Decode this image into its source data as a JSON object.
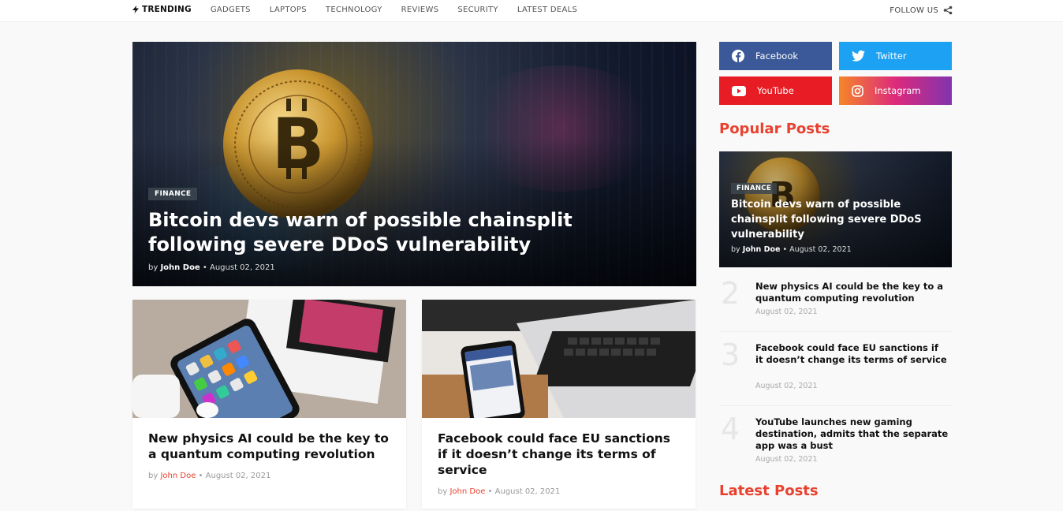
{
  "nav": {
    "trending": "TRENDING",
    "items": [
      "GADGETS",
      "LAPTOPS",
      "TECHNOLOGY",
      "REVIEWS",
      "SECURITY",
      "LATEST DEALS"
    ],
    "follow": "FOLLOW US"
  },
  "hero": {
    "badge": "FINANCE",
    "title": "Bitcoin devs warn of possible chainsplit following severe DDoS vulnerability",
    "by": "by",
    "author": "John Doe",
    "date": "August 02, 2021"
  },
  "cards": [
    {
      "title": "New physics AI could be the key to a quantum computing revolution",
      "by": "by",
      "author": "John Doe",
      "date": "August 02, 2021"
    },
    {
      "title": "Facebook could face EU sanctions if it doesn’t change its terms of service",
      "by": "by",
      "author": "John Doe",
      "date": "August 02, 2021"
    }
  ],
  "social": {
    "facebook": "Facebook",
    "twitter": "Twitter",
    "youtube": "YouTube",
    "instagram": "Instagram"
  },
  "colors": {
    "accent": "#e8412f",
    "facebook": "#3b5998",
    "twitter": "#1da1f2",
    "youtube": "#e81c24"
  },
  "popular": {
    "heading": "Popular Posts",
    "hero": {
      "badge": "FINANCE",
      "title": "Bitcoin devs warn of possible chainsplit following severe DDoS vulnerability",
      "by": "by",
      "author": "John Doe",
      "date": "August 02, 2021"
    },
    "items": [
      {
        "num": "2",
        "title": "New physics AI could be the key to a quantum computing revolution",
        "date": "August 02, 2021"
      },
      {
        "num": "3",
        "title": "Facebook could face EU sanctions if it doesn’t change its terms of service",
        "date": "August 02, 2021"
      },
      {
        "num": "4",
        "title": "YouTube launches new gaming destination, admits that the separate app was a bust",
        "date": "August 02, 2021"
      }
    ]
  },
  "latest": {
    "heading": "Latest Posts"
  }
}
